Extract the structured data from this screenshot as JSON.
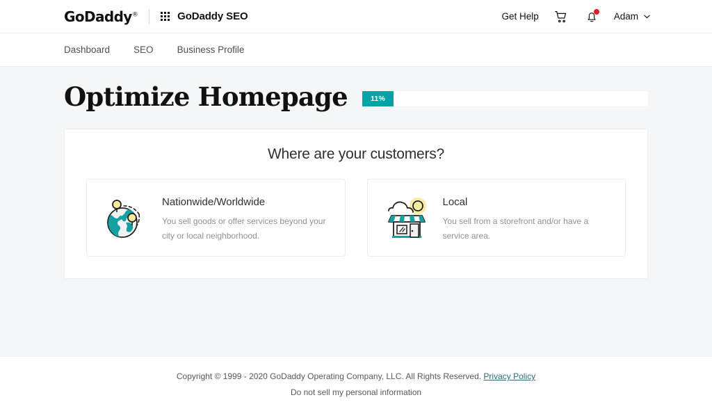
{
  "header": {
    "logo_text": "GoDaddy",
    "logo_tm": "®",
    "app_switcher_icon": "grid-dots-icon",
    "app_name": "GoDaddy SEO",
    "get_help_label": "Get Help",
    "cart_icon": "shopping-cart-icon",
    "notifications_icon": "bell-icon",
    "has_notification": true,
    "account_name": "Adam",
    "account_chevron_icon": "chevron-down-icon"
  },
  "nav": {
    "items": [
      {
        "label": "Dashboard"
      },
      {
        "label": "SEO"
      },
      {
        "label": "Business Profile"
      }
    ]
  },
  "main": {
    "page_title": "Optimize Homepage",
    "progress": {
      "percent": 11,
      "label": "11%",
      "fill_color": "#00a4a6",
      "track_color": "#ffffff"
    },
    "panel": {
      "heading": "Where are your customers?",
      "options": [
        {
          "icon": "globe-with-pins-icon",
          "title": "Nationwide/Worldwide",
          "description": "You sell goods or offer services beyond your city or local neighborhood."
        },
        {
          "icon": "storefront-icon",
          "title": "Local",
          "description": "You sell from a storefront and/or have a service area."
        }
      ]
    }
  },
  "footer": {
    "copyright": "Copyright © 1999 - 2020 GoDaddy Operating Company, LLC. All Rights Reserved.",
    "privacy_link": "Privacy Policy",
    "do_not_sell": "Do not sell my personal information"
  },
  "colors": {
    "teal": "#00a4a6",
    "page_background": "#f5f6f7",
    "notification_red": "#e01e2b",
    "icon_yellow": "#fbe9a0"
  }
}
